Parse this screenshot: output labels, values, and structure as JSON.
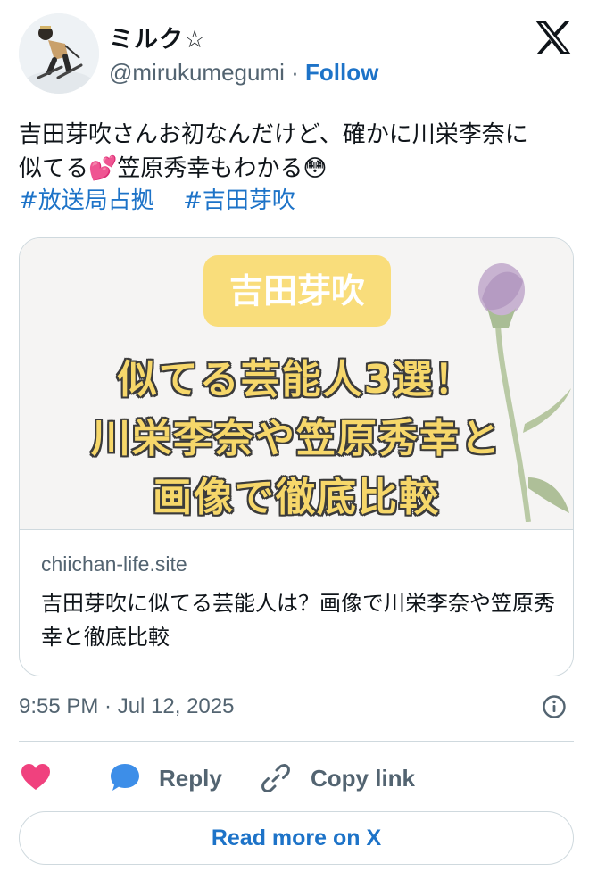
{
  "author": {
    "display_name": "ミルク☆",
    "handle": "@mirukumegumi",
    "separator": "·",
    "follow_label": "Follow"
  },
  "post": {
    "text_line1": "吉田芽吹さんお初なんだけど、確かに川栄李奈に",
    "text_line2_a": "似てる",
    "emoji_hearts": "💕",
    "text_line2_b": "笠原秀幸もわかる",
    "emoji_flushed": "😳",
    "hashtags": [
      "#放送局占拠",
      "#吉田芽吹"
    ]
  },
  "link_card": {
    "image": {
      "pill_text": "吉田芽吹",
      "headline_lines": [
        "似てる芸能人3選！",
        "川栄李奈や笠原秀幸と",
        "画像で徹底比較"
      ],
      "accent_color": "#f9dd7b"
    },
    "domain": "chiichan-life.site",
    "description": "吉田芽吹に似てる芸能人は？画像で川栄李奈や笠原秀幸と徹底比較"
  },
  "meta": {
    "timestamp": "9:55 PM · Jul 12, 2025"
  },
  "actions": {
    "reply_label": "Reply",
    "copy_label": "Copy link",
    "read_more_label": "Read more on X"
  },
  "icons": [
    "x-logo-icon",
    "info-icon",
    "heart-icon",
    "reply-icon",
    "link-icon"
  ],
  "colors": {
    "link": "#1d73c8",
    "secondary_text": "#536471",
    "heart": "#f0417e",
    "reply": "#3d8ee8"
  }
}
